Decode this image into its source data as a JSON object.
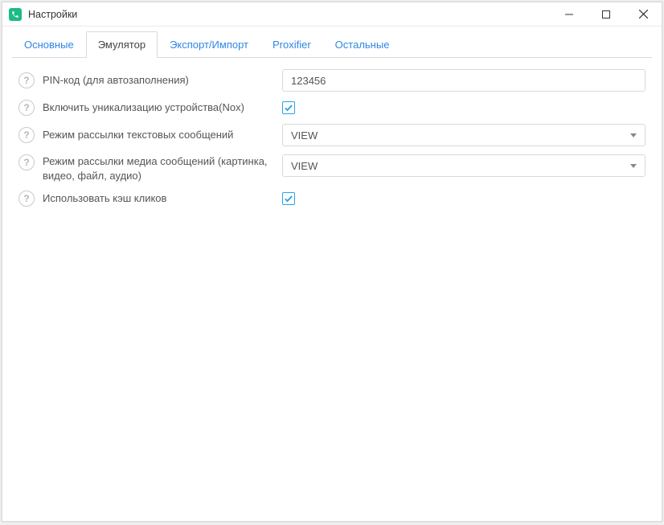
{
  "window": {
    "title": "Настройки"
  },
  "tabs": [
    {
      "label": "Основные",
      "active": false
    },
    {
      "label": "Эмулятор",
      "active": true
    },
    {
      "label": "Экспорт/Импорт",
      "active": false
    },
    {
      "label": "Proxifier",
      "active": false
    },
    {
      "label": "Остальные",
      "active": false
    }
  ],
  "fields": {
    "pin": {
      "label": "PIN-код (для автозаполнения)",
      "value": "123456"
    },
    "unique_device": {
      "label": "Включить уникализацию устройства(Nox)",
      "checked": true
    },
    "text_mode": {
      "label": "Режим рассылки текстовых сообщений",
      "value": "VIEW"
    },
    "media_mode": {
      "label": "Режим рассылки медиа сообщений (картинка, видео, файл, аудио)",
      "value": "VIEW"
    },
    "click_cache": {
      "label": "Использовать кэш кликов",
      "checked": true
    }
  },
  "help_glyph": "?"
}
